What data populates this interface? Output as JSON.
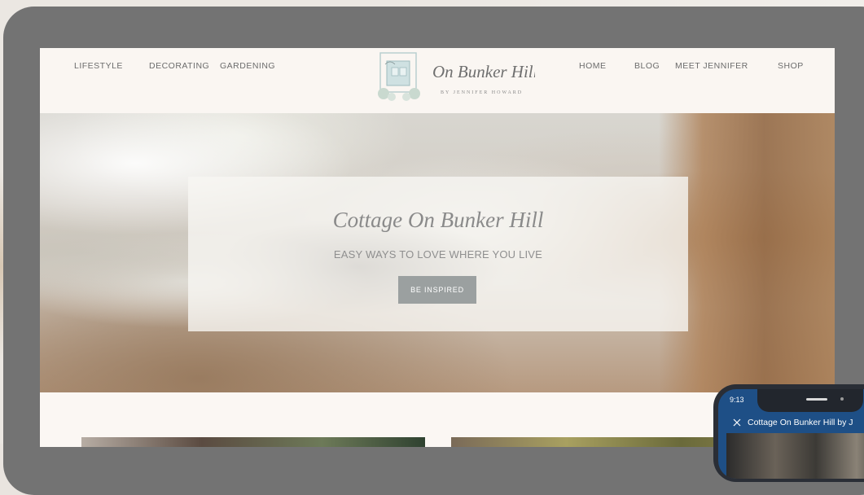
{
  "nav": {
    "left": [
      "LIFESTYLE",
      "DECORATING",
      "GARDENING"
    ],
    "right": [
      "HOME",
      "BLOG",
      "MEET JENNIFER",
      "SHOP"
    ]
  },
  "logo": {
    "script": "On Bunker Hill",
    "byline": "BY JENNIFER HOWARD"
  },
  "hero": {
    "title": "Cottage On Bunker Hill",
    "tagline": "EASY WAYS TO LOVE WHERE YOU LIVE",
    "button": "BE INSPIRED"
  },
  "phone": {
    "time": "9:13",
    "title": "Cottage On Bunker Hill by J"
  },
  "colors": {
    "frame": "#737373",
    "header_bg": "#faf6f2",
    "button_bg": "#9ba0a0",
    "nav_text": "#6c6c6c",
    "phone_header": "#1e4f86"
  }
}
